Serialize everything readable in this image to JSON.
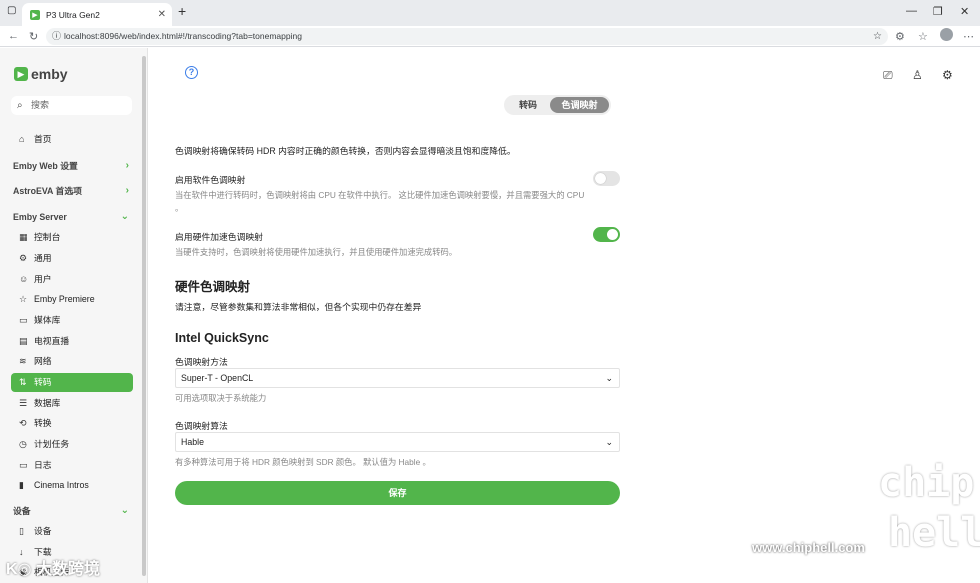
{
  "browser": {
    "tab_title": "P3 Ultra Gen2",
    "tab_close": "✕",
    "new_tab": "+",
    "url": "localhost:8096/web/index.html#!/transcoding?tab=tonemapping",
    "minimize": "—",
    "restore": "❐",
    "close": "✕"
  },
  "sidebar": {
    "logo": "emby",
    "search_placeholder": "搜索",
    "home": "首页",
    "sections": {
      "emby_web": "Emby Web 设置",
      "astroeva": "AstroEVA 首选项",
      "emby_server": "Emby Server",
      "devices": "设备"
    },
    "items": [
      {
        "label": "控制台",
        "icon": "dashboard-icon"
      },
      {
        "label": "通用",
        "icon": "gear-icon"
      },
      {
        "label": "用户",
        "icon": "users-icon"
      },
      {
        "label": "Emby Premiere",
        "icon": "star-icon"
      },
      {
        "label": "媒体库",
        "icon": "folder-icon"
      },
      {
        "label": "电视直播",
        "icon": "tv-icon"
      },
      {
        "label": "网络",
        "icon": "wifi-icon"
      },
      {
        "label": "转码",
        "icon": "transcode-icon"
      },
      {
        "label": "数据库",
        "icon": "database-icon"
      },
      {
        "label": "转换",
        "icon": "convert-icon"
      },
      {
        "label": "计划任务",
        "icon": "clock-icon"
      },
      {
        "label": "日志",
        "icon": "log-icon"
      },
      {
        "label": "Cinema Intros",
        "icon": "film-icon"
      }
    ],
    "device_items": [
      {
        "label": "设备"
      },
      {
        "label": "下载"
      },
      {
        "label": "相机上传"
      }
    ]
  },
  "header": {
    "help": "?",
    "tabs": [
      "转码",
      "色调映射"
    ],
    "active_tab": "色调映射"
  },
  "main": {
    "intro": "色调映射将确保转码 HDR 内容时正确的颜色转换，否则内容会显得暗淡且饱和度降低。",
    "sw_label": "启用软件色调映射",
    "sw_desc_1": "当在软件中进行转码时，色调映射将由 CPU 在软件中执行。 这比硬件加速色调映射要慢，并且需要强大的 CPU",
    "sw_desc_2": "。",
    "sw_enabled": false,
    "hw_label": "启用硬件加速色调映射",
    "hw_desc": "当硬件支持时，色调映射将使用硬件加速执行，并且使用硬件加速完成转码。",
    "hw_enabled": true,
    "hw_title": "硬件色调映射",
    "hw_note": "请注意，尽管参数集和算法非常相似，但各个实现中仍存在差异",
    "qs_title": "Intel QuickSync",
    "method_label": "色调映射方法",
    "method_value": "Super-T - OpenCL",
    "method_help": "可用选项取决于系统能力",
    "algo_label": "色调映射算法",
    "algo_value": "Hable",
    "algo_help": "有多种算法可用于将 HDR 颜色映射到 SDR 颜色。 默认值为 Hable 。",
    "save": "保存"
  },
  "watermarks": {
    "left": "K◎ 大数跨境",
    "chip": "chip",
    "hell": "hell",
    "site": "www.chiphell.com"
  }
}
